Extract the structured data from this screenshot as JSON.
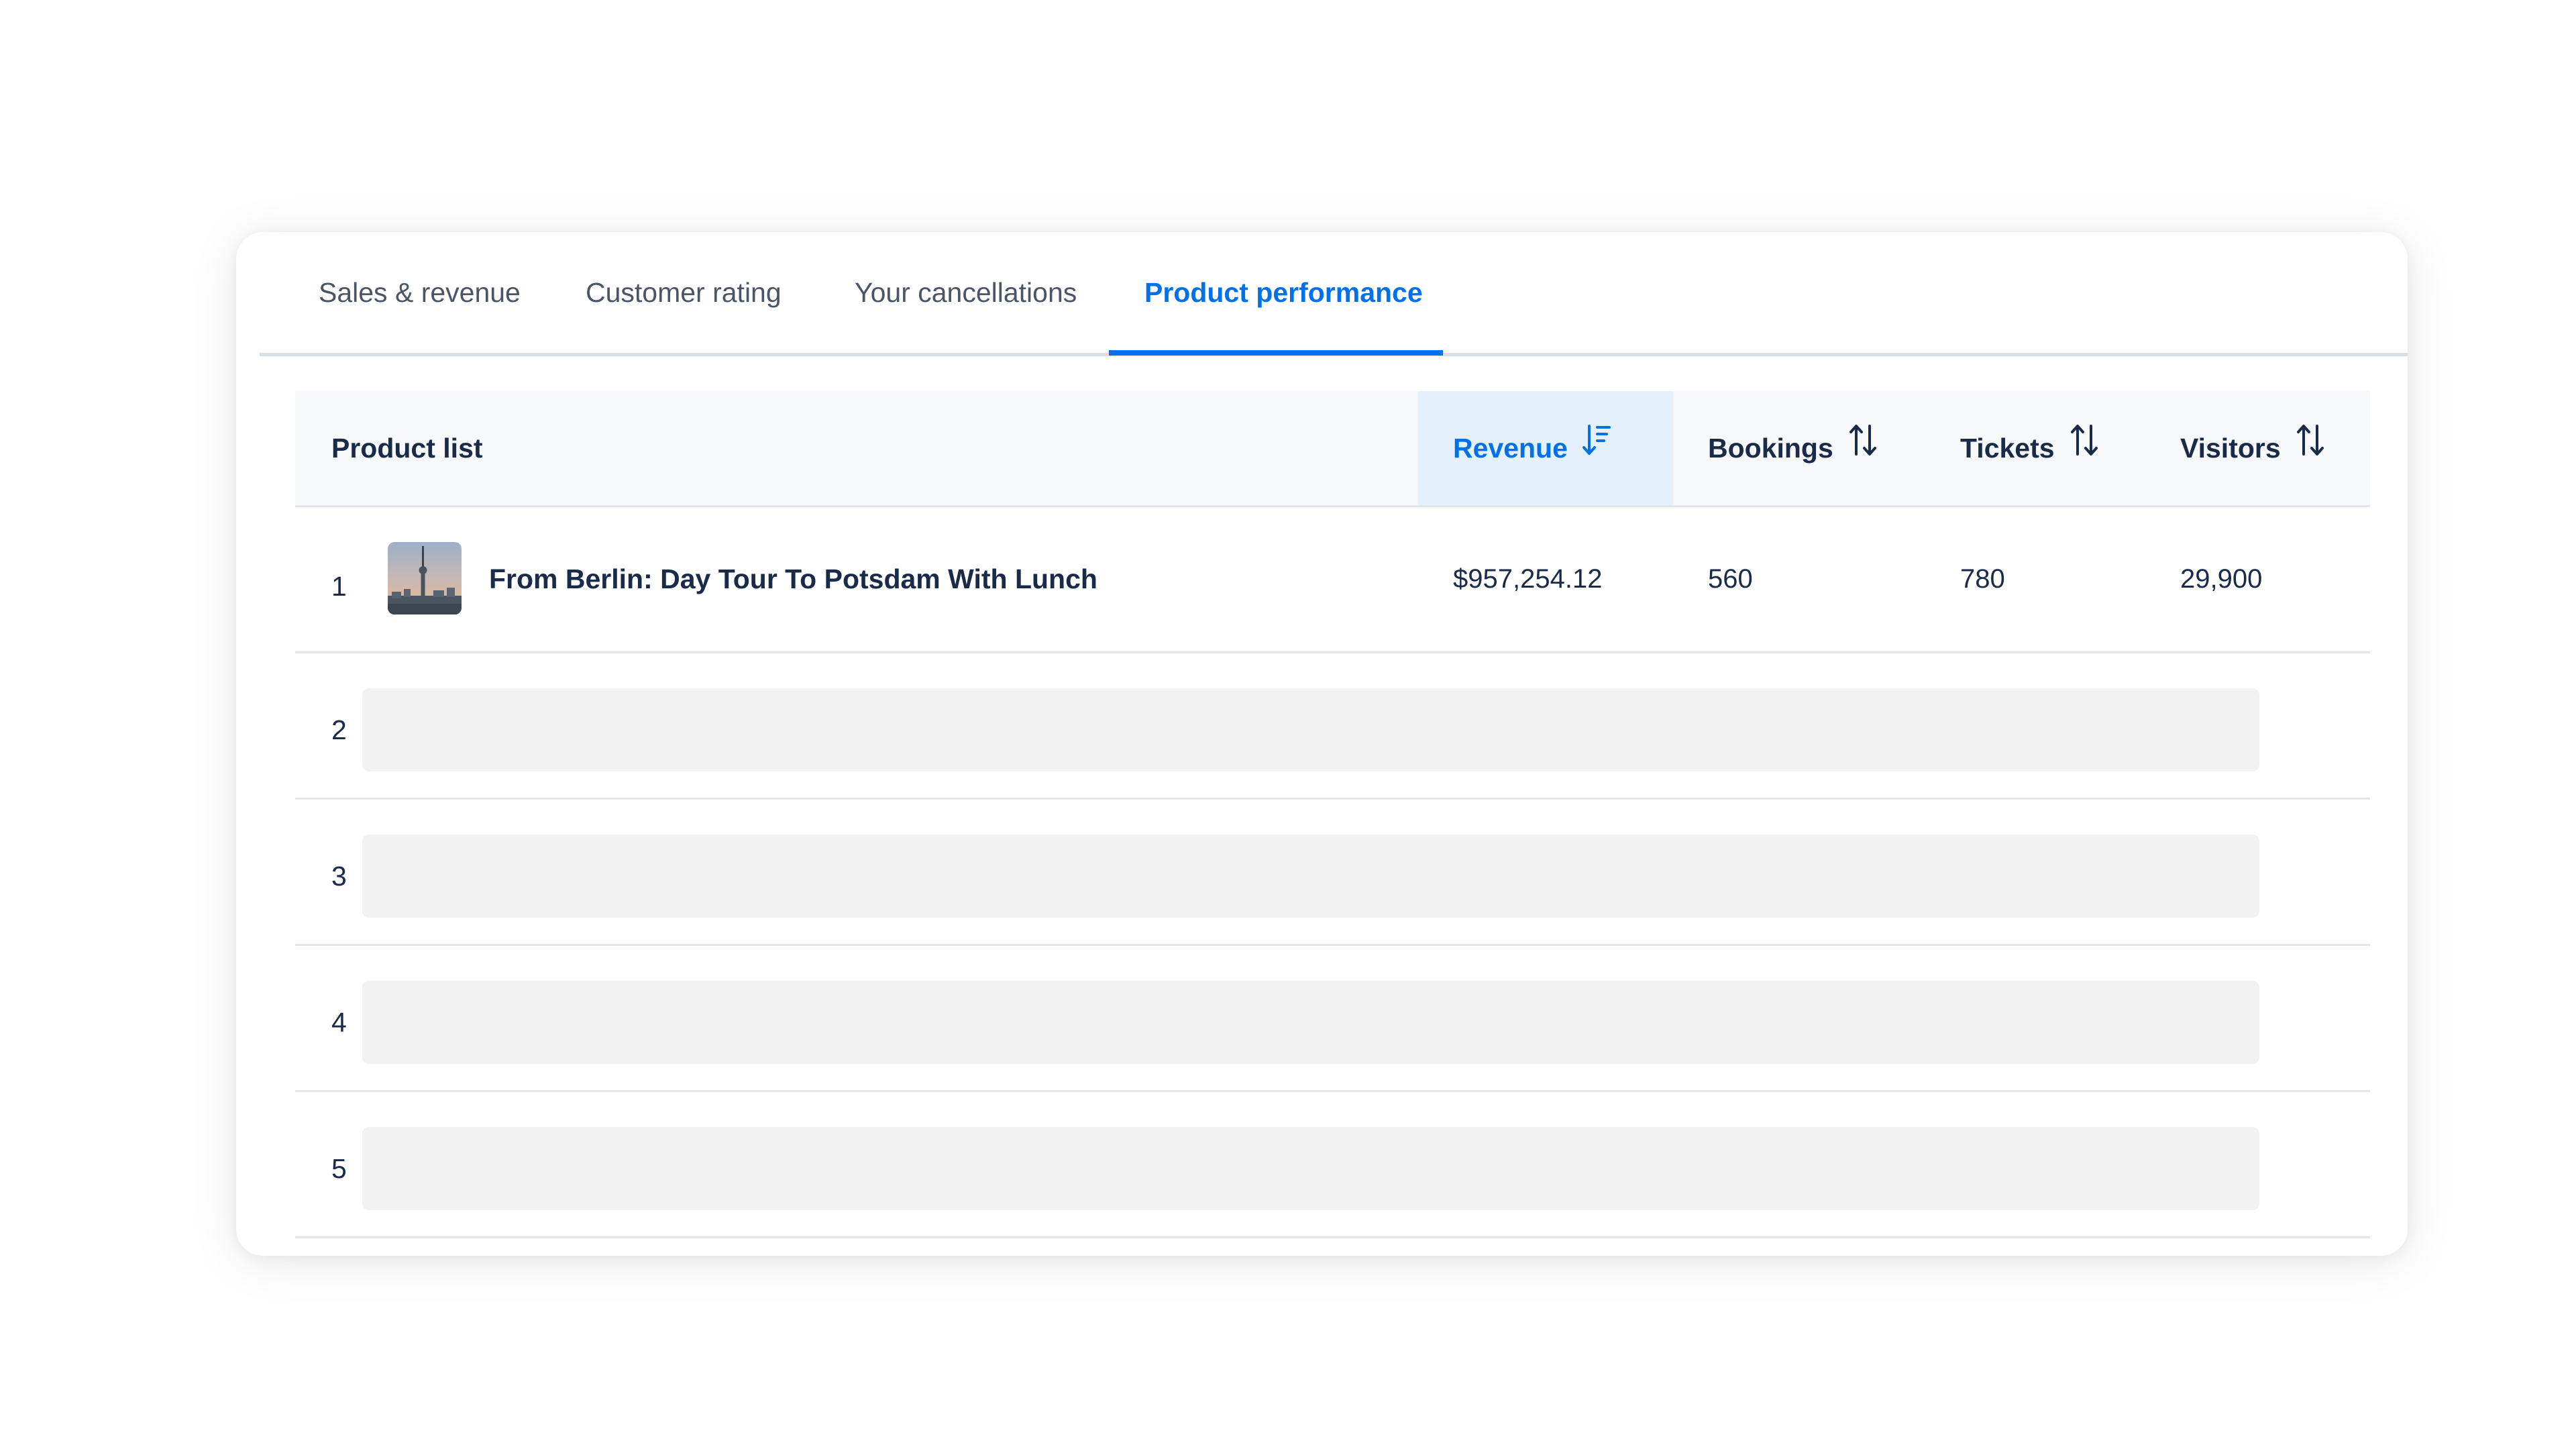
{
  "tabs": [
    {
      "label": "Sales & revenue"
    },
    {
      "label": "Customer rating"
    },
    {
      "label": "Your cancellations"
    },
    {
      "label": "Product performance",
      "active": true
    }
  ],
  "table": {
    "headers": {
      "product_list": "Product list",
      "revenue": "Revenue",
      "bookings": "Bookings",
      "tickets": "Tickets",
      "visitors": "Visitors"
    },
    "sorted_by": "Revenue",
    "rows": [
      {
        "rank": "1",
        "thumbnail": "berlin-tv-tower-photo",
        "product": "From Berlin: Day Tour To Potsdam With Lunch",
        "revenue": "$957,254.12",
        "bookings": "560",
        "tickets": "780",
        "visitors": "29,900"
      },
      {
        "rank": "2",
        "placeholder": true
      },
      {
        "rank": "3",
        "placeholder": true
      },
      {
        "rank": "4",
        "placeholder": true
      },
      {
        "rank": "5",
        "placeholder": true
      }
    ]
  },
  "colors": {
    "accent": "#0071eb",
    "text": "#1a2b49",
    "muted_tab": "#4a5568",
    "header_bg": "#f6f8fa",
    "active_sort_bg": "#e4f0fc",
    "skeleton": "#f2f2f2"
  },
  "icons": {
    "revenue_sort": "sort-descending-icon",
    "column_sort": "sort-arrows-icon"
  }
}
